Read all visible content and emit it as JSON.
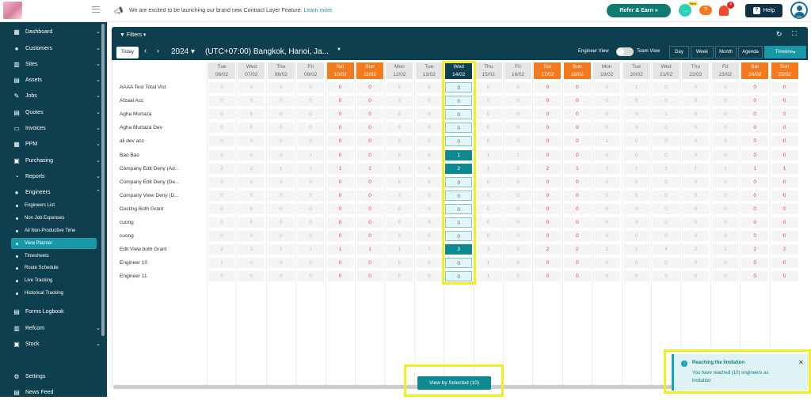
{
  "topbar": {
    "announcement": "We are excited to be launching our brand new Contract Layer Feature.",
    "learn_more": "Learn more",
    "refer_label": "Refer & Earn",
    "chat_badge": "New",
    "notif_count": "4",
    "help_label": "Help"
  },
  "sidebar": {
    "items": [
      {
        "label": "Dashboard",
        "icon": "dashboard-icon",
        "glyph": "▦"
      },
      {
        "label": "Customers",
        "icon": "customers-icon",
        "glyph": "●"
      },
      {
        "label": "Sites",
        "icon": "sites-icon",
        "glyph": "▥"
      },
      {
        "label": "Assets",
        "icon": "assets-icon",
        "glyph": "▤"
      },
      {
        "label": "Jobs",
        "icon": "jobs-icon",
        "glyph": "✎"
      },
      {
        "label": "Quotes",
        "icon": "quotes-icon",
        "glyph": "▤"
      },
      {
        "label": "Invoices",
        "icon": "invoices-icon",
        "glyph": "▭"
      },
      {
        "label": "PPM",
        "icon": "ppm-icon",
        "glyph": "▦"
      },
      {
        "label": "Purchasing",
        "icon": "purchasing-icon",
        "glyph": "▣"
      },
      {
        "label": "Reports",
        "icon": "reports-icon",
        "glyph": "◔"
      },
      {
        "label": "Engineers",
        "icon": "engineers-icon",
        "glyph": "●"
      }
    ],
    "engineer_sub": [
      "Engineers List",
      "Non Job Expenses",
      "All Non-Productive Time",
      "View Planner",
      "Timesheets",
      "Route Schedule",
      "Live Tracking",
      "Historical Tracking"
    ],
    "active_sub": "View Planner",
    "bottom_items": [
      {
        "label": "Forms Logbook",
        "icon": "forms-logbook-icon",
        "glyph": "▤"
      },
      {
        "label": "Refcom",
        "icon": "refcom-icon",
        "glyph": "▥"
      },
      {
        "label": "Stock",
        "icon": "stock-icon",
        "glyph": "▣"
      }
    ],
    "footer_items": [
      {
        "label": "Settings",
        "icon": "settings-icon",
        "glyph": "⚙"
      },
      {
        "label": "News Feed",
        "icon": "news-feed-icon",
        "glyph": "▤"
      }
    ]
  },
  "planner": {
    "filters_label": "Filters",
    "today_label": "Today",
    "year": "2024",
    "timezone": "(UTC+07:00) Bangkok, Hanoi, Ja...",
    "engineer_view_label": "Engineer View",
    "team_view_label": "Team View",
    "view_buttons": [
      "Day",
      "Week",
      "Month",
      "Agenda",
      "Timeline"
    ],
    "active_view": "Timeline",
    "dates": [
      {
        "day": "Tue",
        "date": "06/02",
        "type": "normal"
      },
      {
        "day": "Wed",
        "date": "07/02",
        "type": "normal"
      },
      {
        "day": "Thu",
        "date": "08/02",
        "type": "normal"
      },
      {
        "day": "Fri",
        "date": "09/02",
        "type": "normal"
      },
      {
        "day": "Sat",
        "date": "10/02",
        "type": "weekend"
      },
      {
        "day": "Sun",
        "date": "11/02",
        "type": "weekend"
      },
      {
        "day": "Mon",
        "date": "12/02",
        "type": "normal"
      },
      {
        "day": "Tue",
        "date": "13/02",
        "type": "normal"
      },
      {
        "day": "Wed",
        "date": "14/02",
        "type": "today"
      },
      {
        "day": "Thu",
        "date": "15/02",
        "type": "normal"
      },
      {
        "day": "Fri",
        "date": "16/02",
        "type": "normal"
      },
      {
        "day": "Sat",
        "date": "17/02",
        "type": "weekend"
      },
      {
        "day": "Sun",
        "date": "18/02",
        "type": "weekend"
      },
      {
        "day": "Mon",
        "date": "19/02",
        "type": "normal"
      },
      {
        "day": "Tue",
        "date": "20/02",
        "type": "normal"
      },
      {
        "day": "Wed",
        "date": "21/02",
        "type": "normal"
      },
      {
        "day": "Thu",
        "date": "22/02",
        "type": "normal"
      },
      {
        "day": "Fri",
        "date": "23/02",
        "type": "normal"
      },
      {
        "day": "Sat",
        "date": "24/02",
        "type": "weekend"
      },
      {
        "day": "Sun",
        "date": "25/02",
        "type": "weekend"
      }
    ],
    "today_index": 8,
    "engineers": [
      {
        "name": "AAAA Test Total Vist",
        "values": [
          0,
          0,
          0,
          0,
          0,
          0,
          0,
          0,
          0,
          0,
          0,
          0,
          0,
          0,
          1,
          0,
          0,
          0,
          0,
          0
        ]
      },
      {
        "name": "Afzaal Acc",
        "values": [
          0,
          0,
          0,
          0,
          0,
          0,
          0,
          0,
          0,
          0,
          0,
          0,
          0,
          0,
          0,
          0,
          0,
          0,
          0,
          0
        ]
      },
      {
        "name": "Agha Murtaza",
        "values": [
          0,
          0,
          0,
          0,
          0,
          0,
          0,
          0,
          0,
          0,
          0,
          0,
          0,
          0,
          0,
          1,
          0,
          0,
          0,
          0
        ]
      },
      {
        "name": "Agha Murtaza Dev",
        "values": [
          0,
          0,
          0,
          0,
          0,
          0,
          0,
          0,
          0,
          0,
          0,
          0,
          0,
          0,
          0,
          0,
          0,
          0,
          0,
          0
        ]
      },
      {
        "name": "ali dev acc",
        "values": [
          0,
          0,
          0,
          0,
          0,
          0,
          0,
          0,
          0,
          0,
          0,
          0,
          0,
          1,
          0,
          0,
          0,
          0,
          0,
          0
        ]
      },
      {
        "name": "Bao Bao",
        "values": [
          0,
          0,
          0,
          1,
          0,
          0,
          0,
          0,
          1,
          1,
          1,
          0,
          0,
          0,
          0,
          0,
          0,
          0,
          0,
          0
        ]
      },
      {
        "name": "Company Edit Deny (Ad...",
        "values": [
          2,
          2,
          1,
          1,
          1,
          1,
          1,
          4,
          2,
          2,
          2,
          2,
          1,
          1,
          1,
          1,
          1,
          1,
          1,
          1
        ]
      },
      {
        "name": "Company Edit Deny (De...",
        "values": [
          0,
          0,
          0,
          0,
          0,
          0,
          0,
          0,
          0,
          0,
          0,
          0,
          0,
          0,
          0,
          0,
          0,
          0,
          0,
          0
        ]
      },
      {
        "name": "Company View Deny (D...",
        "values": [
          0,
          0,
          0,
          0,
          0,
          0,
          0,
          0,
          0,
          0,
          0,
          0,
          0,
          0,
          0,
          0,
          0,
          0,
          0,
          0
        ]
      },
      {
        "name": "Costing Both Grant",
        "values": [
          0,
          0,
          0,
          0,
          0,
          0,
          0,
          0,
          0,
          0,
          0,
          0,
          0,
          0,
          0,
          0,
          0,
          0,
          0,
          0
        ]
      },
      {
        "name": "cuong",
        "values": [
          0,
          0,
          0,
          0,
          0,
          0,
          0,
          0,
          0,
          0,
          0,
          0,
          0,
          0,
          0,
          0,
          0,
          0,
          0,
          0
        ]
      },
      {
        "name": "cuong",
        "values": [
          0,
          0,
          0,
          0,
          0,
          0,
          0,
          0,
          0,
          0,
          0,
          0,
          0,
          0,
          0,
          0,
          0,
          0,
          0,
          0
        ]
      },
      {
        "name": "Edit View both Grant",
        "values": [
          2,
          2,
          1,
          1,
          1,
          1,
          1,
          7,
          3,
          3,
          3,
          2,
          2,
          2,
          2,
          4,
          2,
          2,
          2,
          2
        ]
      },
      {
        "name": "Engineer 10",
        "values": [
          1,
          0,
          0,
          0,
          0,
          0,
          0,
          0,
          0,
          1,
          0,
          0,
          0,
          0,
          0,
          0,
          0,
          0,
          0,
          0
        ]
      },
      {
        "name": "Engineer 11",
        "values": [
          0,
          0,
          0,
          0,
          0,
          0,
          0,
          0,
          0,
          1,
          0,
          0,
          0,
          0,
          0,
          0,
          0,
          0,
          0,
          0
        ]
      }
    ],
    "selected_rows": [
      2,
      3,
      4,
      5,
      6,
      8,
      11,
      12,
      13,
      14
    ],
    "view_selected_label": "View by Selected (10)"
  },
  "toast": {
    "title": "Reaching the limitation",
    "message": "You have reached (10) engineers as limitation"
  }
}
